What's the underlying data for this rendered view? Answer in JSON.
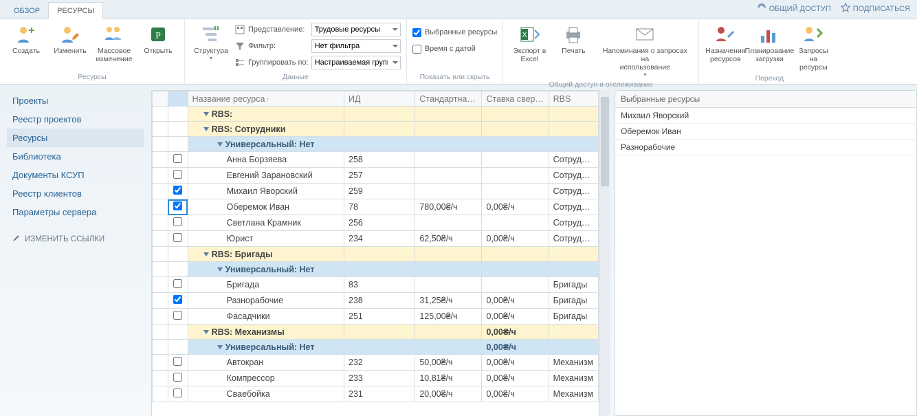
{
  "tabs": {
    "overview": "ОБЗОР",
    "resources": "РЕСУРСЫ"
  },
  "topActions": {
    "share": "ОБЩИЙ ДОСТУП",
    "subscribe": "ПОДПИСАТЬСЯ"
  },
  "ribbon": {
    "groups": {
      "resourcesLabel": "Ресурсы",
      "dataLabel": "Данные",
      "showLabel": "Показать или скрыть",
      "shareLabel": "Общий доступ и отслеживание",
      "navLabel": "Переход"
    },
    "buttons": {
      "create": "Создать",
      "edit": "Изменить",
      "bulkEdit": "Массовое\nизменение",
      "open": "Открыть",
      "structure": "Структура",
      "viewLabel": "Представление:",
      "filterLabel": "Фильтр:",
      "groupLabel": "Группировать по:",
      "viewSel": "Трудовые ресурсы",
      "filterSel": "Нет фильтра",
      "groupSel": "Настраиваемая групп",
      "chkSelected": "Выбранные ресурсы",
      "chkTime": "Время с датой",
      "exportExcel": "Экспорт в\nExcel",
      "print": "Печать",
      "reminders": "Напоминания о запросах на\nиспользование",
      "assignments": "Назначения\nресурсов",
      "loadPlanning": "Планирование\nзагрузки",
      "resourceRequests": "Запросы на\nресурсы"
    }
  },
  "sidebar": {
    "items": [
      "Проекты",
      "Реестр проектов",
      "Ресурсы",
      "Библиотека",
      "Документы КСУП",
      "Реестр клиентов",
      "Параметры сервера"
    ],
    "editLinks": "ИЗМЕНИТЬ ССЫЛКИ"
  },
  "grid": {
    "headers": {
      "name": "Название ресурса",
      "id": "ИД",
      "rate": "Стандартная ст",
      "over": "Ставка сверхур",
      "rbs": "RBS"
    },
    "groups": [
      {
        "level": 1,
        "label": "RBS:"
      },
      {
        "level": 1,
        "label": "RBS: Сотрудники"
      },
      {
        "level": 2,
        "label": "Универсальный: Нет"
      }
    ],
    "rows1": [
      {
        "chk": false,
        "name": "Анна Борзяева",
        "id": "258",
        "rate": "",
        "over": "",
        "rbs": "Сотрудник"
      },
      {
        "chk": false,
        "name": "Евгений Зарановский",
        "id": "257",
        "rate": "",
        "over": "",
        "rbs": "Сотрудник"
      },
      {
        "chk": true,
        "name": "Михаил Яворский",
        "id": "259",
        "rate": "",
        "over": "",
        "rbs": "Сотрудник"
      },
      {
        "chk": true,
        "name": "Оберемок Иван",
        "id": "78",
        "rate": "780,00₴/ч",
        "over": "0,00₴/ч",
        "rbs": "Сотрудник",
        "focus": true
      },
      {
        "chk": false,
        "name": "Светлана Крамник",
        "id": "256",
        "rate": "",
        "over": "",
        "rbs": "Сотрудник"
      },
      {
        "chk": false,
        "name": "Юрист",
        "id": "234",
        "rate": "62,50₴/ч",
        "over": "0,00₴/ч",
        "rbs": "Сотрудник"
      }
    ],
    "groups2": [
      {
        "level": 1,
        "label": "RBS: Бригады"
      },
      {
        "level": 2,
        "label": "Универсальный: Нет"
      }
    ],
    "rows2": [
      {
        "chk": false,
        "name": "Бригада",
        "id": "83",
        "rate": "",
        "over": "",
        "rbs": "Бригады"
      },
      {
        "chk": true,
        "name": "Разнорабочие",
        "id": "238",
        "rate": "31,25₴/ч",
        "over": "0,00₴/ч",
        "rbs": "Бригады"
      },
      {
        "chk": false,
        "name": "Фасадчики",
        "id": "251",
        "rate": "125,00₴/ч",
        "over": "0,00₴/ч",
        "rbs": "Бригады"
      }
    ],
    "groups3": [
      {
        "level": 1,
        "label": "RBS: Механизмы",
        "over": "0,00₴/ч"
      },
      {
        "level": 2,
        "label": "Универсальный: Нет",
        "over": "0,00₴/ч"
      }
    ],
    "rows3": [
      {
        "chk": false,
        "name": "Автокран",
        "id": "232",
        "rate": "50,00₴/ч",
        "over": "0,00₴/ч",
        "rbs": "Механизм"
      },
      {
        "chk": false,
        "name": "Компрессор",
        "id": "233",
        "rate": "10,81₴/ч",
        "over": "0,00₴/ч",
        "rbs": "Механизм"
      },
      {
        "chk": false,
        "name": "Сваебойка",
        "id": "231",
        "rate": "20,00₴/ч",
        "over": "0,00₴/ч",
        "rbs": "Механизм"
      }
    ]
  },
  "rightPanel": {
    "title": "Выбранные ресурсы",
    "items": [
      "Михаил Яворский",
      "Оберемок Иван",
      "Разнорабочие"
    ]
  }
}
